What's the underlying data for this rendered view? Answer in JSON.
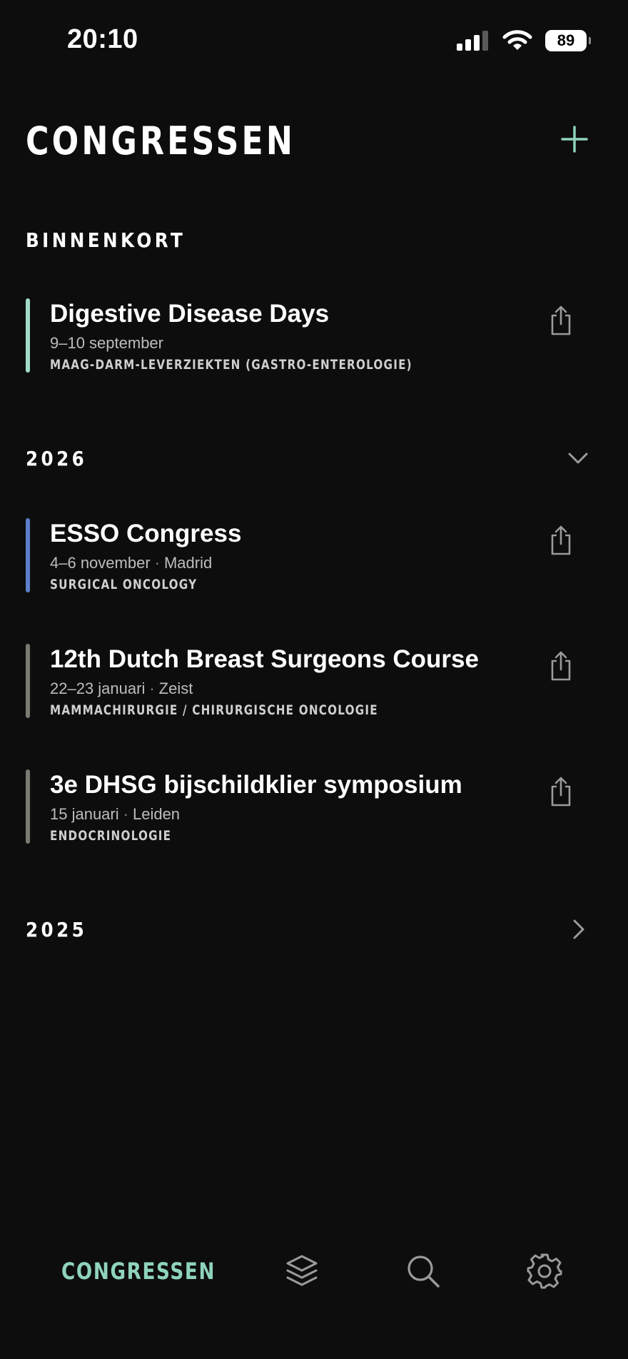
{
  "status_bar": {
    "time": "20:10",
    "battery": "89"
  },
  "header": {
    "title": "CONGRESSEN",
    "add_icon": "plus-icon"
  },
  "colors": {
    "accent": "#8fd3bd",
    "background": "#0d0d0d",
    "bar_gastro": "#9fdcc6",
    "bar_surgical": "#5b7fc9",
    "bar_gray": "#7a7a72"
  },
  "sections": {
    "upcoming": {
      "label": "BINNENKORT",
      "items": [
        {
          "title": "Digestive Disease Days",
          "date": "9–10 september",
          "location": "",
          "category": "MAAG-DARM-LEVERZIEKTEN (GASTRO-ENTEROLOGIE)"
        }
      ]
    },
    "y2026": {
      "label": "2026",
      "toggle_icon": "chevron-down-icon",
      "items": [
        {
          "title": "ESSO Congress",
          "date": "4–6 november",
          "location": "Madrid",
          "category": "SURGICAL ONCOLOGY"
        },
        {
          "title": "12th Dutch Breast Surgeons Course",
          "date": "22–23 januari",
          "location": "Zeist",
          "category": "MAMMACHIRURGIE / CHIRURGISCHE ONCOLOGIE"
        },
        {
          "title": "3e DHSG bijschildklier symposium",
          "date": "15 januari",
          "location": "Leiden",
          "category": "ENDOCRINOLOGIE"
        }
      ]
    },
    "y2025": {
      "label": "2025",
      "toggle_icon": "chevron-right-icon"
    }
  },
  "meta_separator": "·",
  "tab_bar": {
    "congressen_label": "CONGRESSEN",
    "icons": [
      "layers-icon",
      "search-icon",
      "gear-icon"
    ]
  }
}
